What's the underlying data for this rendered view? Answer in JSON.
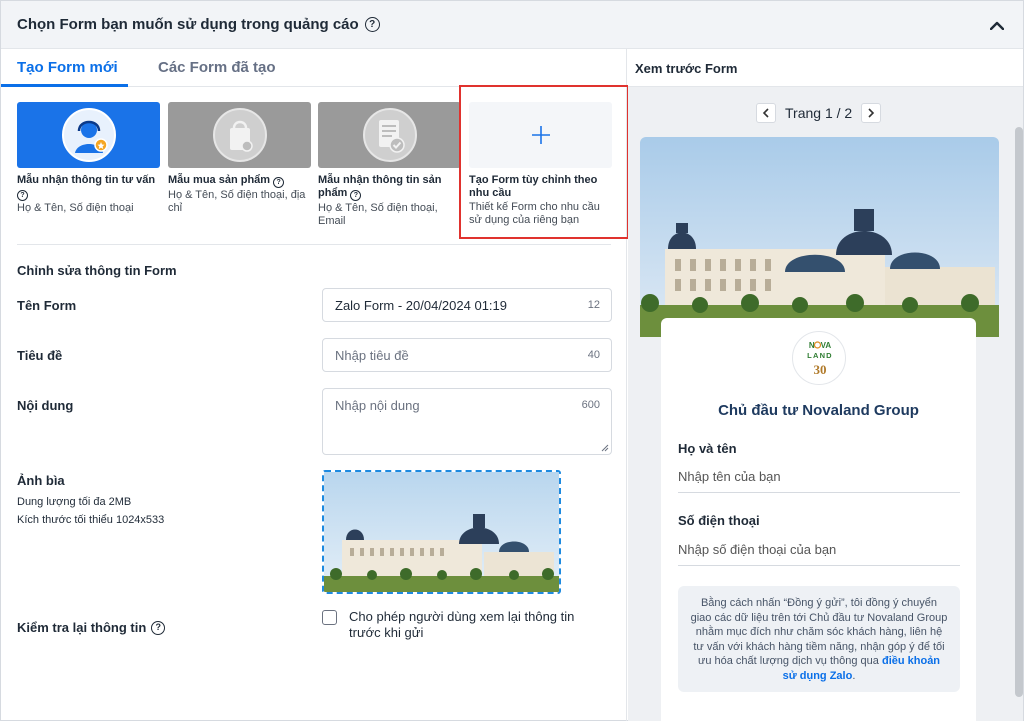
{
  "header": {
    "title": "Chọn Form bạn muốn sử dụng trong quảng cáo",
    "help_icon": "question-circle-icon",
    "collapse_icon": "chevron-up-icon"
  },
  "tabs": [
    {
      "label": "Tạo Form mới",
      "active": true
    },
    {
      "label": "Các Form đã tạo",
      "active": false
    }
  ],
  "templates": [
    {
      "title": "Mẫu nhận thông tin tư vấn",
      "desc": "Họ & Tên, Số điện thoại",
      "icon": "consultant-icon"
    },
    {
      "title": "Mẫu mua sản phẩm",
      "desc": "Họ & Tên, Số điện thoại, địa chỉ",
      "icon": "shopping-bag-icon"
    },
    {
      "title": "Mẫu nhận thông tin sản phẩm",
      "desc": "Họ & Tên, Số điện thoại, Email",
      "icon": "document-check-icon"
    },
    {
      "title": "Tạo Form tùy chỉnh theo nhu cầu",
      "desc": "Thiết kế Form cho nhu cầu sử dụng của riêng bạn",
      "icon": "plus-icon"
    }
  ],
  "edit_section": {
    "title": "Chỉnh sửa thông tin Form",
    "form_name": {
      "label": "Tên Form",
      "value": "Zalo Form - 20/04/2024 01:19",
      "count": "12"
    },
    "heading": {
      "label": "Tiêu đề",
      "placeholder": "Nhập tiêu đề",
      "count": "40"
    },
    "content": {
      "label": "Nội dung",
      "placeholder": "Nhập nội dung",
      "count": "600"
    },
    "cover": {
      "label": "Ảnh bìa",
      "size_note": "Dung lượng tối đa 2MB",
      "dim_note": "Kích thước tối thiểu 1024x533"
    },
    "review": {
      "label": "Kiểm tra lại thông tin",
      "checkbox_text": "Cho phép người dùng xem lại thông tin trước khi gửi",
      "checked": false
    }
  },
  "preview": {
    "title": "Xem trước Form",
    "page_text": "Trang 1 / 2",
    "logo_text_1": "N",
    "logo_text_2": "VA",
    "logo_text_3": "LAND",
    "logo_text_4": "30",
    "company": "Chủ đầu tư Novaland Group",
    "fields": [
      {
        "label": "Họ và tên",
        "placeholder": "Nhập tên của bạn"
      },
      {
        "label": "Số điện thoại",
        "placeholder": "Nhập số điện thoại của bạn"
      }
    ],
    "consent_text": "Bằng cách nhấn “Đồng ý gửi”, tôi đồng ý chuyển giao các dữ liệu trên tới Chủ đầu tư Novaland Group nhằm mục đích như chăm sóc khách hàng, liên hệ tư vấn với khách hàng tiềm năng, nhận góp ý để tối ưu hóa chất lượng dịch vụ thông qua",
    "consent_link": "điều khoản sử dụng Zalo",
    "consent_end": "."
  },
  "colors": {
    "accent": "#0a6fe8",
    "highlight_border": "#e0322e",
    "card_blue": "#1e3a5f"
  }
}
